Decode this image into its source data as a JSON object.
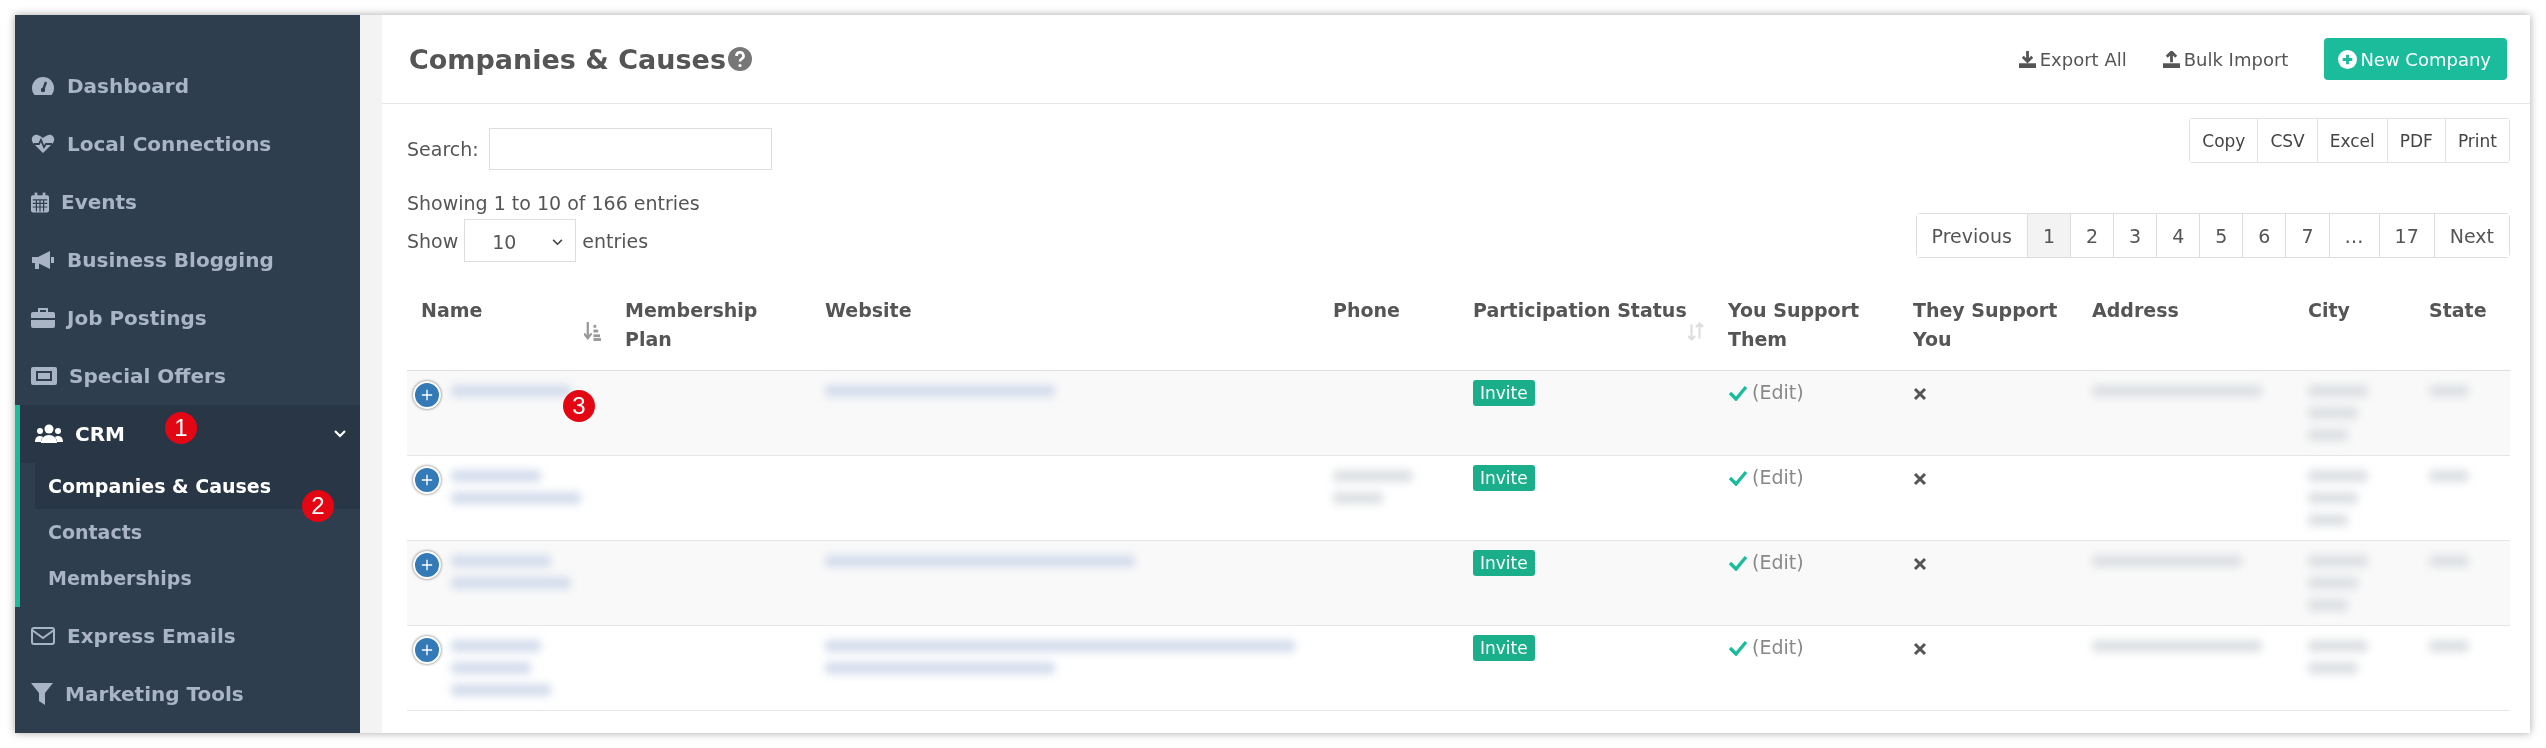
{
  "sidebar": {
    "items": [
      {
        "label": "Dashboard",
        "selected": false
      },
      {
        "label": "Local Connections",
        "selected": false
      },
      {
        "label": "Events",
        "selected": false
      },
      {
        "label": "Business Blogging",
        "selected": false
      },
      {
        "label": "Job Postings",
        "selected": false
      },
      {
        "label": "Special Offers",
        "selected": false
      },
      {
        "label": "CRM",
        "selected": true,
        "expanded": true,
        "children": [
          {
            "label": "Companies & Causes",
            "selected": true
          },
          {
            "label": "Contacts",
            "selected": false
          },
          {
            "label": "Memberships",
            "selected": false
          }
        ]
      },
      {
        "label": "Express Emails",
        "selected": false
      },
      {
        "label": "Marketing Tools",
        "selected": false
      }
    ]
  },
  "header": {
    "title": "Companies & Causes",
    "actions": [
      {
        "label": "Export All",
        "kind": "export"
      },
      {
        "label": "Bulk Import",
        "kind": "import"
      },
      {
        "label": "New Company",
        "kind": "primary"
      }
    ]
  },
  "search": {
    "label": "Search:"
  },
  "export_buttons": [
    "Copy",
    "CSV",
    "Excel",
    "PDF",
    "Print"
  ],
  "info": "Showing 1 to 10 of 166 entries",
  "page_length": {
    "prefix": "Show",
    "value": "10",
    "suffix": "entries"
  },
  "pagination": {
    "previous": "Previous",
    "next": "Next",
    "pages": [
      {
        "label": "1",
        "selected": true
      },
      {
        "label": "2",
        "selected": false
      },
      {
        "label": "3",
        "selected": false
      },
      {
        "label": "4",
        "selected": false
      },
      {
        "label": "5",
        "selected": false
      },
      {
        "label": "6",
        "selected": false
      },
      {
        "label": "7",
        "selected": false
      },
      {
        "label": "…",
        "selected": false
      },
      {
        "label": "17",
        "selected": false
      }
    ]
  },
  "table": {
    "columns": [
      {
        "label": "Name",
        "sortable": true,
        "sorted": true
      },
      {
        "label": "Membership Plan",
        "sortable": false
      },
      {
        "label": "Website",
        "sortable": false
      },
      {
        "label": "Phone",
        "sortable": false
      },
      {
        "label": "Participation Status",
        "sortable": true,
        "sorted": false
      },
      {
        "label": "You Support Them",
        "sortable": false
      },
      {
        "label": "They Support You",
        "sortable": false
      },
      {
        "label": "Address",
        "sortable": false
      },
      {
        "label": "City",
        "sortable": false
      },
      {
        "label": "State",
        "sortable": false
      }
    ],
    "rows": [
      {
        "status": "Invite",
        "you_support": true,
        "edit": "(Edit)",
        "they_support": false
      },
      {
        "status": "Invite",
        "you_support": true,
        "edit": "(Edit)",
        "they_support": false
      },
      {
        "status": "Invite",
        "you_support": true,
        "edit": "(Edit)",
        "they_support": false
      },
      {
        "status": "Invite",
        "you_support": true,
        "edit": "(Edit)",
        "they_support": false
      }
    ]
  },
  "annotations": [
    {
      "label": "1"
    },
    {
      "label": "2"
    },
    {
      "label": "3"
    }
  ]
}
